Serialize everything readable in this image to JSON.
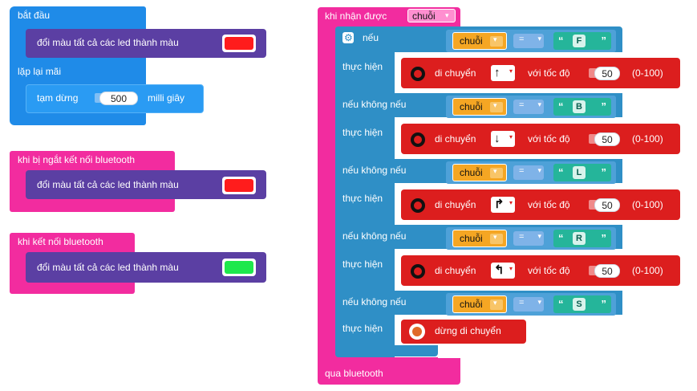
{
  "left": {
    "start_block": {
      "label": "bắt đầu",
      "action_label": "đổi màu tất cả các led thành màu",
      "color": "#ff1c1c"
    },
    "loop_block": {
      "label": "lặp lại mãi",
      "pause_label": "tạm dừng",
      "pause_value": "500",
      "unit_label": "milli giây"
    },
    "disconnect_block": {
      "label": "khi bị ngắt kết nối bluetooth",
      "action_label": "đổi màu tất cả các led thành màu",
      "color": "#ff1c1c"
    },
    "connect_block": {
      "label": "khi kết nối bluetooth",
      "action_label": "đổi màu tất cả các led thành màu",
      "color": "#1ee84c"
    }
  },
  "right": {
    "hat_label": "khi nhận được",
    "hat_var": "chuỗi",
    "footer_label": "qua bluetooth",
    "if_label": "nếu",
    "elseif_label": "nếu không nếu",
    "then_label": "thực hiện",
    "var_name": "chuỗi",
    "eq_label": "=",
    "move_label": "di chuyển",
    "speed_label": "với tốc độ",
    "range_label": "(0-100)",
    "stop_label": "dừng di chuyển",
    "branches": [
      {
        "key": "F",
        "dir_icon": "arrow-up-icon",
        "dir_glyph": "↑",
        "speed": "50"
      },
      {
        "key": "B",
        "dir_icon": "arrow-down-icon",
        "dir_glyph": "↓",
        "speed": "50"
      },
      {
        "key": "L",
        "dir_icon": "turn-right-icon",
        "dir_glyph": "↱",
        "speed": "50"
      },
      {
        "key": "R",
        "dir_icon": "turn-left-icon",
        "dir_glyph": "↰",
        "speed": "50"
      },
      {
        "key": "S"
      }
    ]
  }
}
